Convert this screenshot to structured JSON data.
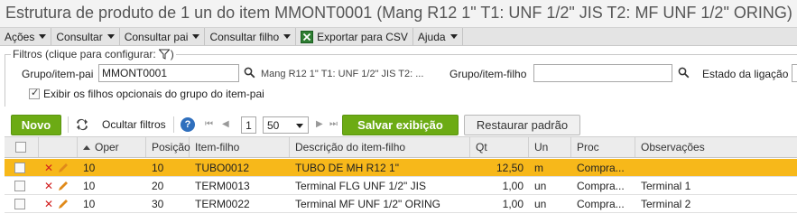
{
  "title": "Estrutura de produto de 1 un do item MMONT0001 (Mang R12 1\" T1: UNF 1/2\" JIS T2: MF UNF 1/2\" ORING)",
  "menu": {
    "acoes": "Ações",
    "consultar": "Consultar",
    "consultar_pai": "Consultar pai",
    "consultar_filho": "Consultar filho",
    "exportar_csv": "Exportar para CSV",
    "ajuda": "Ajuda"
  },
  "filters": {
    "legend": "Filtros (clique para configurar:",
    "grupo_pai_label": "Grupo/item-pai",
    "grupo_pai_value": "MMONT0001",
    "grupo_pai_desc": "Mang R12 1\" T1: UNF 1/2\" JIS T2: ...",
    "grupo_filho_label": "Grupo/item-filho",
    "grupo_filho_value": "",
    "estado_label": "Estado da ligação",
    "exibir_label": "Exibir os filhos opcionais do grupo do item-pai",
    "exibir_checked": true
  },
  "toolbar": {
    "novo": "Novo",
    "ocultar_filtros": "Ocultar filtros",
    "page": "1",
    "page_size": "50",
    "salvar": "Salvar exibição",
    "restaurar": "Restaurar padrão"
  },
  "grid": {
    "headers": {
      "oper": "Oper",
      "posicao": "Posição",
      "item_filho": "Item-filho",
      "descricao": "Descrição do item-filho",
      "qt": "Qt",
      "un": "Un",
      "proc": "Proc",
      "observacoes": "Observações"
    },
    "rows": [
      {
        "oper": "10",
        "posicao": "10",
        "item_filho": "TUBO0012",
        "descricao": "TUBO DE MH R12 1\"",
        "qt": "12,50",
        "un": "m",
        "proc": "Compra...",
        "observacoes": "",
        "selected": true
      },
      {
        "oper": "10",
        "posicao": "20",
        "item_filho": "TERM0013",
        "descricao": "Terminal FLG UNF 1/2\" JIS",
        "qt": "1,00",
        "un": "un",
        "proc": "Compra...",
        "observacoes": "Terminal 1",
        "selected": false
      },
      {
        "oper": "10",
        "posicao": "30",
        "item_filho": "TERM0022",
        "descricao": "Terminal MF UNF 1/2\" ORING",
        "qt": "1,00",
        "un": "un",
        "proc": "Compra...",
        "observacoes": "Terminal 2",
        "selected": false
      }
    ]
  },
  "colors": {
    "accent_green": "#6cab14",
    "selected_row": "#f7b81a",
    "delete_red": "#d21f1f",
    "edit_orange": "#e08a1a"
  }
}
